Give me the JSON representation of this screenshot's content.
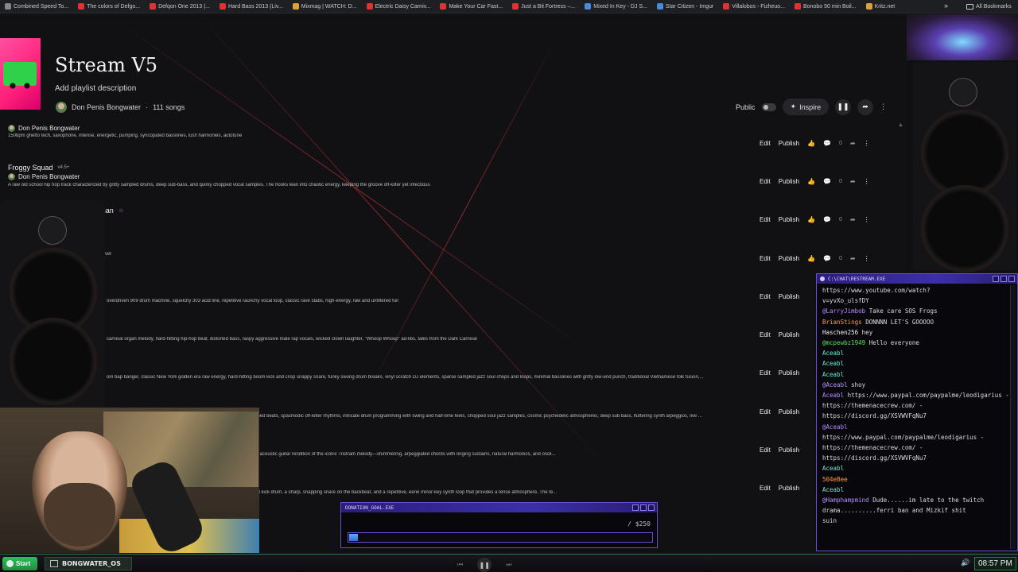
{
  "bookmarks": {
    "items": [
      {
        "label": "Combined Speed To...",
        "icon": "bolt-icon"
      },
      {
        "label": "The colors of Defgo...",
        "icon": "youtube-icon"
      },
      {
        "label": "Defqon One 2013 |...",
        "icon": "youtube-icon"
      },
      {
        "label": "Hard Bass 2013 (Liv...",
        "icon": "youtube-icon"
      },
      {
        "label": "Mixmag | WATCH: D...",
        "icon": "mixmag-icon"
      },
      {
        "label": "Electric Daisy Carniv...",
        "icon": "youtube-icon"
      },
      {
        "label": "Make Your Car Fast...",
        "icon": "youtube-icon"
      },
      {
        "label": "Just a Bit Fortress –...",
        "icon": "youtube-icon"
      },
      {
        "label": "Mixed In Key - DJ S...",
        "icon": "globe-icon"
      },
      {
        "label": "Star Citizen - Imgur",
        "icon": "imgur-icon"
      },
      {
        "label": "Villalobos - Fizheuo...",
        "icon": "youtube-icon"
      },
      {
        "label": "Bonobo 50 min Boil...",
        "icon": "youtube-icon"
      },
      {
        "label": "Kritz.net",
        "icon": "kritz-icon"
      }
    ],
    "more": "»",
    "all_label": "All Bookmarks"
  },
  "playlist": {
    "title": "Stream V5",
    "description": "Add playlist description",
    "owner": "Don Penis Bongwater",
    "song_count": "111 songs",
    "visibility": "Public",
    "inspire_label": "Inspire"
  },
  "row_actions": {
    "edit": "Edit",
    "publish": "Publish"
  },
  "songs": [
    {
      "title": "",
      "version": "",
      "author": "Don Penis Bongwater",
      "tags": "150bpm ghetto tech, saxophone, intense, energetic, pumping, syncopated basslines, lush harmonies, autotune",
      "likes": "0"
    },
    {
      "title": "Froggy Squad",
      "version": "v4.5+",
      "author": "Don Penis Bongwater",
      "tags": "A raw old school hip hop track characterized by gritty sampled drums, deep sub-bass, and quirky chopped vocal samples. The hooks lean into chaotic energy, keeping the groove off-kilter yet infectious",
      "likes": "0"
    },
    {
      "title": "Do You Want to F*ck a Snowman",
      "version": "",
      "author": "",
      "tags": "",
      "likes": "0"
    },
    {
      "title": "",
      "version": "",
      "author": "",
      "tags": "ver",
      "likes": "0"
    },
    {
      "title": "",
      "version": "",
      "author": "",
      "tags": "overdriven 909 drum machine, squelchy 303 acid line, repetitive raunchy vocal loop, classic rave stabs, high-energy, raw and unfiltered fun",
      "likes": ""
    },
    {
      "title": "",
      "version": "",
      "author": "",
      "tags": "carnival organ melody, hard-hitting hip-hop beat, distorted bass, raspy aggressive male rap vocals, wicked clown laughter, \"Whoop Whoop\" ad-libs, tales from the Dark Carnival",
      "likes": ""
    },
    {
      "title": "",
      "version": "",
      "author": "",
      "tags": "om bap banger, classic New York golden era raw energy, hard-hitting boom kick and crisp snappy snare, funky swung drum breaks, vinyl scratch DJ elements, sparse sampled jazz soul chops and loops, minimal basslines with gritty low-end punch, traditional Vietnamese folk fusion,...",
      "likes": ""
    },
    {
      "title": "",
      "version": "",
      "author": "",
      "tags": "al, Flying Lotus inspired fusion of avant-garde jazz and IDM, glitchy warped beats, spasmodic off-kilter rhythms, intricate drum programming with swing and half-time feels, chopped soul jazz samples, cosmic psychedelic atmospheres, deep sub bass, fluttering synth arpeggios, live ...",
      "likes": ""
    },
    {
      "title": "",
      "version": "",
      "author": "",
      "tags": "ge theme from Diablo II, The song opens with a slow, brooding 12-string acoustic guitar rendition of the iconic Tristram melody—shimmering, arpeggiated chords with ringing sustains, natural harmonics, and oscil...",
      "likes": ""
    },
    {
      "title": "",
      "version": "",
      "author": "",
      "tags": "inimalist boom-bap production style, The beat features a heavy, distorted kick drum, a sharp, snapping snare on the backbeat, and a repetitive, eerie minor-key synth loop that provides a tense atmosphere, The te...",
      "likes": ""
    }
  ],
  "chat": {
    "title": "C:\\CHAT\\RESTREAM.EXE",
    "messages": [
      {
        "user": "",
        "text": "https://www.youtube.com/watch?",
        "cls": "u-name"
      },
      {
        "user": "",
        "text": "v=yvXo_ulsfDY",
        "cls": "u-name"
      },
      {
        "user": "@LarryJimbob",
        "text": "Take care SOS Frogs",
        "cls": "u-purple"
      },
      {
        "user": "BrianStings",
        "text": "DONNNN LET'S GOOOOO",
        "cls": "u-orange"
      },
      {
        "user": "Haschen256",
        "text": "hey",
        "cls": "u-name"
      },
      {
        "user": "@mcpewbz1949",
        "text": "Hello everyone",
        "cls": "u-green"
      },
      {
        "user": "Aceabl",
        "text": "",
        "cls": "u-teal"
      },
      {
        "user": "Aceabl",
        "text": "",
        "cls": "u-teal"
      },
      {
        "user": "Aceabl",
        "text": "",
        "cls": "u-teal"
      },
      {
        "user": "@Aceabl",
        "text": "shoy",
        "cls": "u-purple"
      },
      {
        "user": "Aceabl",
        "text": "https://www.paypal.com/paypalme/leodigarius -",
        "cls": "u-purple"
      },
      {
        "user": "",
        "text": "https://themenacecrew.com/ -",
        "cls": "u-name"
      },
      {
        "user": "",
        "text": "https://discord.gg/XSVWVFqNu7",
        "cls": "u-name"
      },
      {
        "user": "@Aceabl",
        "text": "",
        "cls": "u-purple"
      },
      {
        "user": "",
        "text": "https://www.paypal.com/paypalme/leodigarius -",
        "cls": "u-name"
      },
      {
        "user": "",
        "text": "https://themenacecrew.com/ -",
        "cls": "u-name"
      },
      {
        "user": "",
        "text": "https://discord.gg/XSVWVFqNu7",
        "cls": "u-name"
      },
      {
        "user": "Aceabl",
        "text": "",
        "cls": "u-teal"
      },
      {
        "user": "504eBee",
        "text": "",
        "cls": "u-orange"
      },
      {
        "user": "Aceabl",
        "text": "",
        "cls": "u-teal"
      },
      {
        "user": "@Hamphampmind",
        "text": "Dude......im late to the twitch",
        "cls": "u-purple"
      },
      {
        "user": "",
        "text": "drama..........ferri ban and Mizkif shit",
        "cls": "u-name"
      },
      {
        "user": "",
        "text": "suin",
        "cls": "u-name"
      }
    ]
  },
  "donation": {
    "title": "DONATION_GOAL.EXE",
    "goal": "/ $250",
    "progress": 0.03
  },
  "taskbar": {
    "start": "Start",
    "app": "BONGWATER_OS",
    "time": "08:57 PM"
  }
}
